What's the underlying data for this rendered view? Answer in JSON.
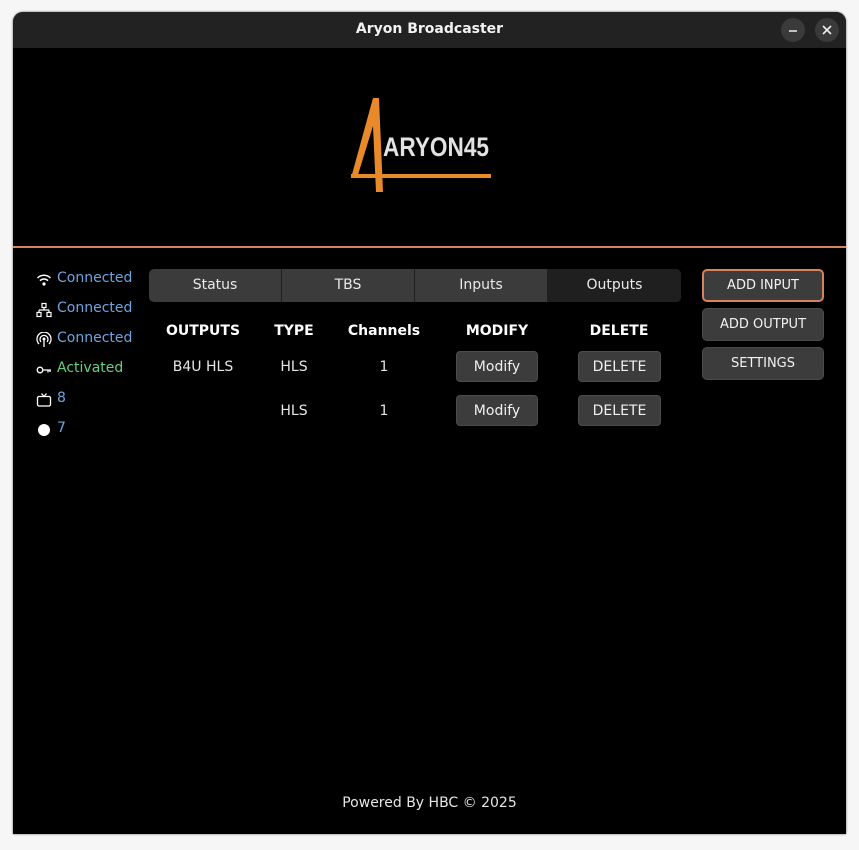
{
  "window": {
    "title": "Aryon Broadcaster"
  },
  "logo": {
    "text": "ARYON45",
    "accent_color": "#e8892a"
  },
  "status": [
    {
      "icon": "wifi-icon",
      "label": "Connected",
      "color": "#6ea4e0"
    },
    {
      "icon": "network-icon",
      "label": "Connected",
      "color": "#6ea4e0"
    },
    {
      "icon": "broadcast-icon",
      "label": "Connected",
      "color": "#6ea4e0"
    },
    {
      "icon": "key-icon",
      "label": "Activated",
      "color": "#67d07f"
    },
    {
      "icon": "tv-icon",
      "label": "8",
      "color": "#6ea4e0"
    },
    {
      "icon": "record-dot-icon",
      "label": "7",
      "color": "#6ea4e0"
    }
  ],
  "tabs": [
    {
      "label": "Status"
    },
    {
      "label": "TBS"
    },
    {
      "label": "Inputs"
    },
    {
      "label": "Outputs",
      "active": true
    }
  ],
  "outputs_table": {
    "headers": [
      "OUTPUTS",
      "TYPE",
      "Channels",
      "MODIFY",
      "DELETE"
    ],
    "rows": [
      {
        "name": "B4U HLS",
        "type": "HLS",
        "channels": "1",
        "modify": "Modify",
        "delete": "DELETE"
      },
      {
        "name": "",
        "type": "HLS",
        "channels": "1",
        "modify": "Modify",
        "delete": "DELETE"
      }
    ]
  },
  "actions": {
    "add_input": "ADD INPUT",
    "add_output": "ADD OUTPUT",
    "settings": "SETTINGS"
  },
  "footer": "Powered By HBC © 2025"
}
